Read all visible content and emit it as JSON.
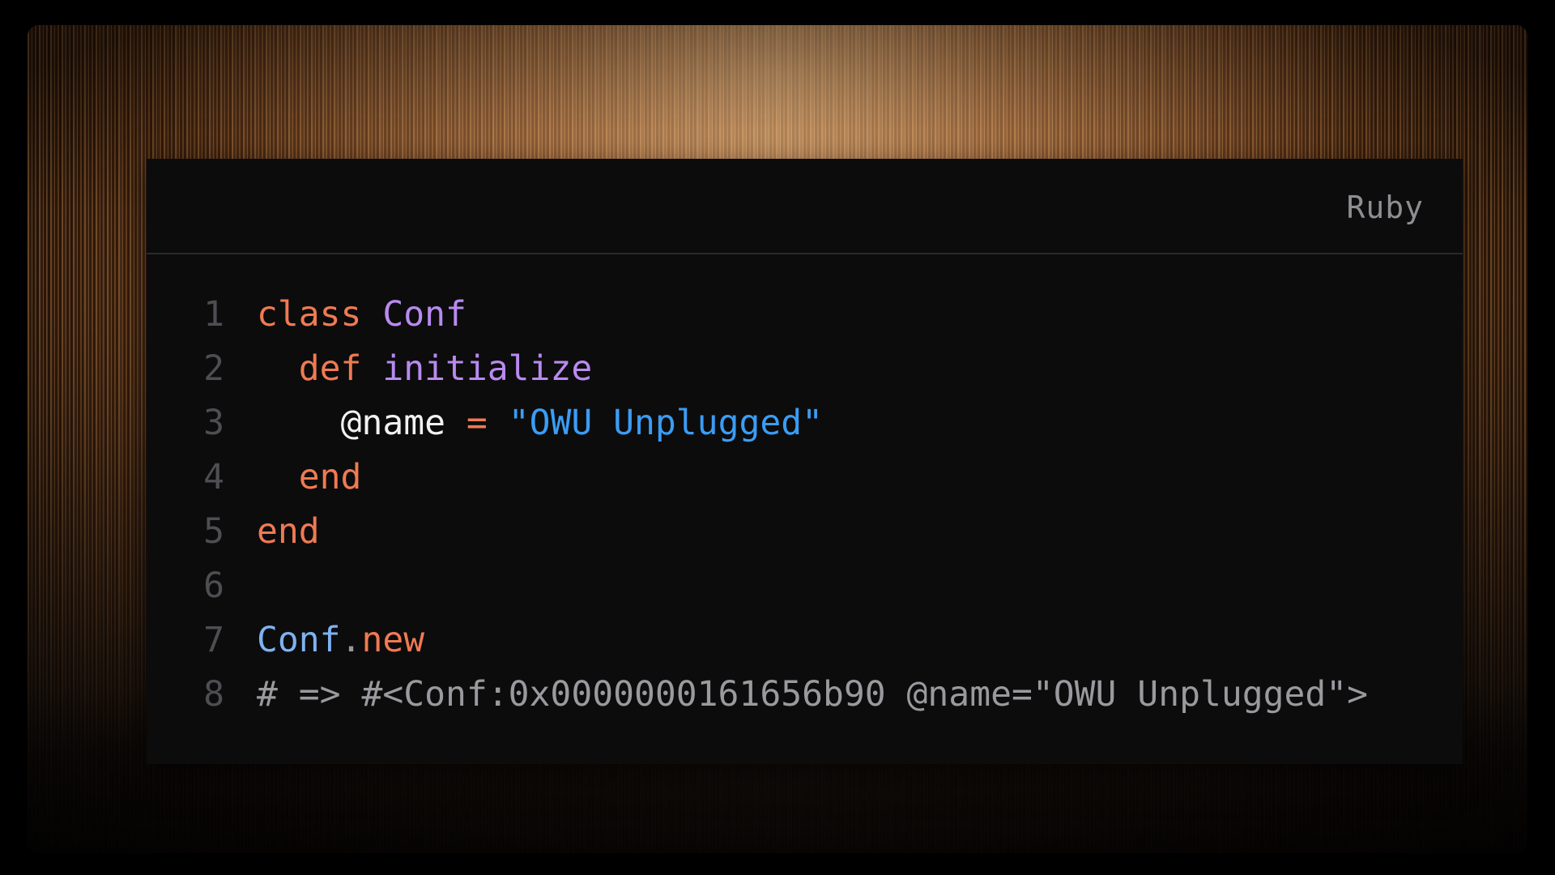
{
  "window": {
    "language_label": "Ruby"
  },
  "code": {
    "lines": [
      {
        "number": "1",
        "tokens": [
          {
            "type": "kw",
            "text": "class"
          },
          {
            "type": "plain",
            "text": " "
          },
          {
            "type": "cls",
            "text": "Conf"
          }
        ]
      },
      {
        "number": "2",
        "tokens": [
          {
            "type": "plain",
            "text": "  "
          },
          {
            "type": "kw",
            "text": "def"
          },
          {
            "type": "plain",
            "text": " "
          },
          {
            "type": "fn",
            "text": "initialize"
          }
        ]
      },
      {
        "number": "3",
        "tokens": [
          {
            "type": "plain",
            "text": "    "
          },
          {
            "type": "ivar",
            "text": "@name"
          },
          {
            "type": "plain",
            "text": " "
          },
          {
            "type": "op",
            "text": "="
          },
          {
            "type": "plain",
            "text": " "
          },
          {
            "type": "str",
            "text": "\"OWU Unplugged\""
          }
        ]
      },
      {
        "number": "4",
        "tokens": [
          {
            "type": "plain",
            "text": "  "
          },
          {
            "type": "kw",
            "text": "end"
          }
        ]
      },
      {
        "number": "5",
        "tokens": [
          {
            "type": "kw",
            "text": "end"
          }
        ]
      },
      {
        "number": "6",
        "tokens": []
      },
      {
        "number": "7",
        "tokens": [
          {
            "type": "const",
            "text": "Conf"
          },
          {
            "type": "cmt",
            "text": "."
          },
          {
            "type": "meth",
            "text": "new"
          }
        ]
      },
      {
        "number": "8",
        "tokens": [
          {
            "type": "cmt",
            "text": "# => #<Conf:0x0000000161656b90 @name=\"OWU Unplugged\">"
          }
        ]
      }
    ]
  },
  "colors": {
    "keyword": "#f07a52",
    "class_name": "#b98af0",
    "string": "#3a9df5",
    "constant": "#7fb2f0",
    "comment": "#9a9a9e",
    "line_number": "#4e4e52",
    "background": "#0c0c0d"
  }
}
